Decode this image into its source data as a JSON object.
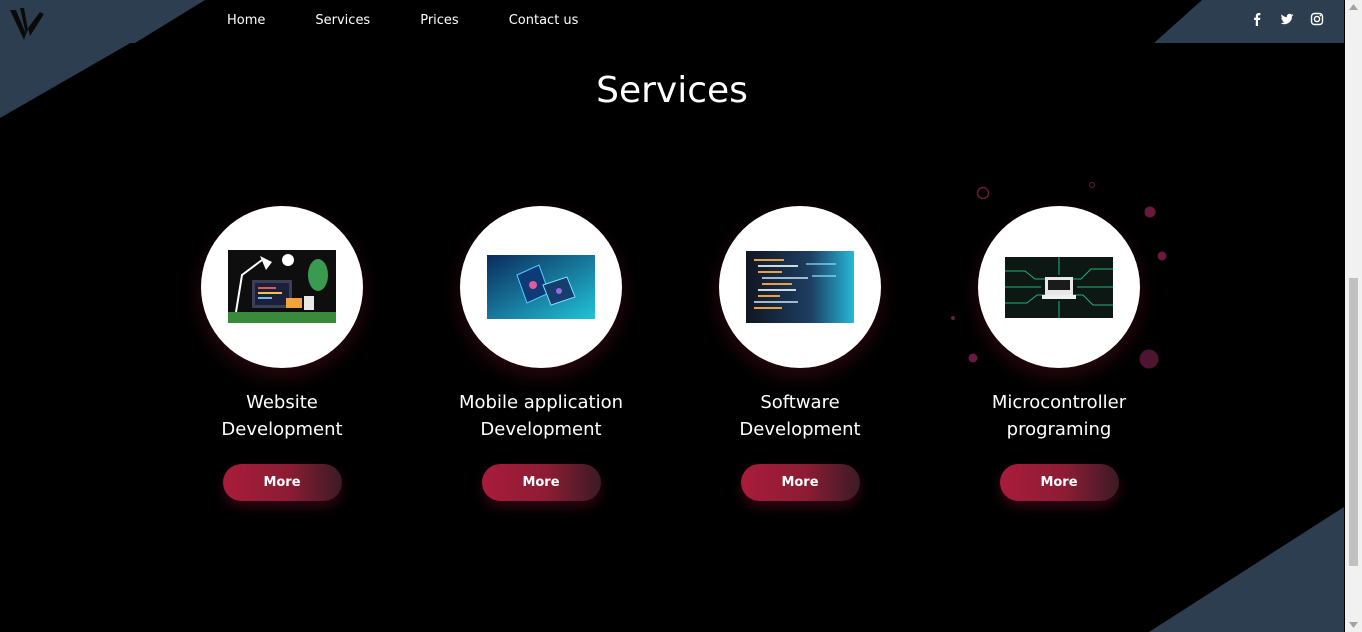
{
  "nav": {
    "items": [
      {
        "label": "Home"
      },
      {
        "label": "Services"
      },
      {
        "label": "Prices"
      },
      {
        "label": "Contact us"
      }
    ],
    "social": [
      "facebook-icon",
      "twitter-icon",
      "instagram-icon"
    ]
  },
  "section": {
    "title": "Services"
  },
  "services": [
    {
      "title_line1": "Website",
      "title_line2": "Development",
      "button": "More"
    },
    {
      "title_line1": "Mobile application",
      "title_line2": "Development",
      "button": "More"
    },
    {
      "title_line1": "Software",
      "title_line2": "Development",
      "button": "More"
    },
    {
      "title_line1": "Microcontroller",
      "title_line2": "programing",
      "button": "More"
    }
  ],
  "colors": {
    "background": "#000000",
    "navbar": "#2c3e50",
    "accent": "#a91c3a",
    "decor_dots": "#7a1a45"
  }
}
